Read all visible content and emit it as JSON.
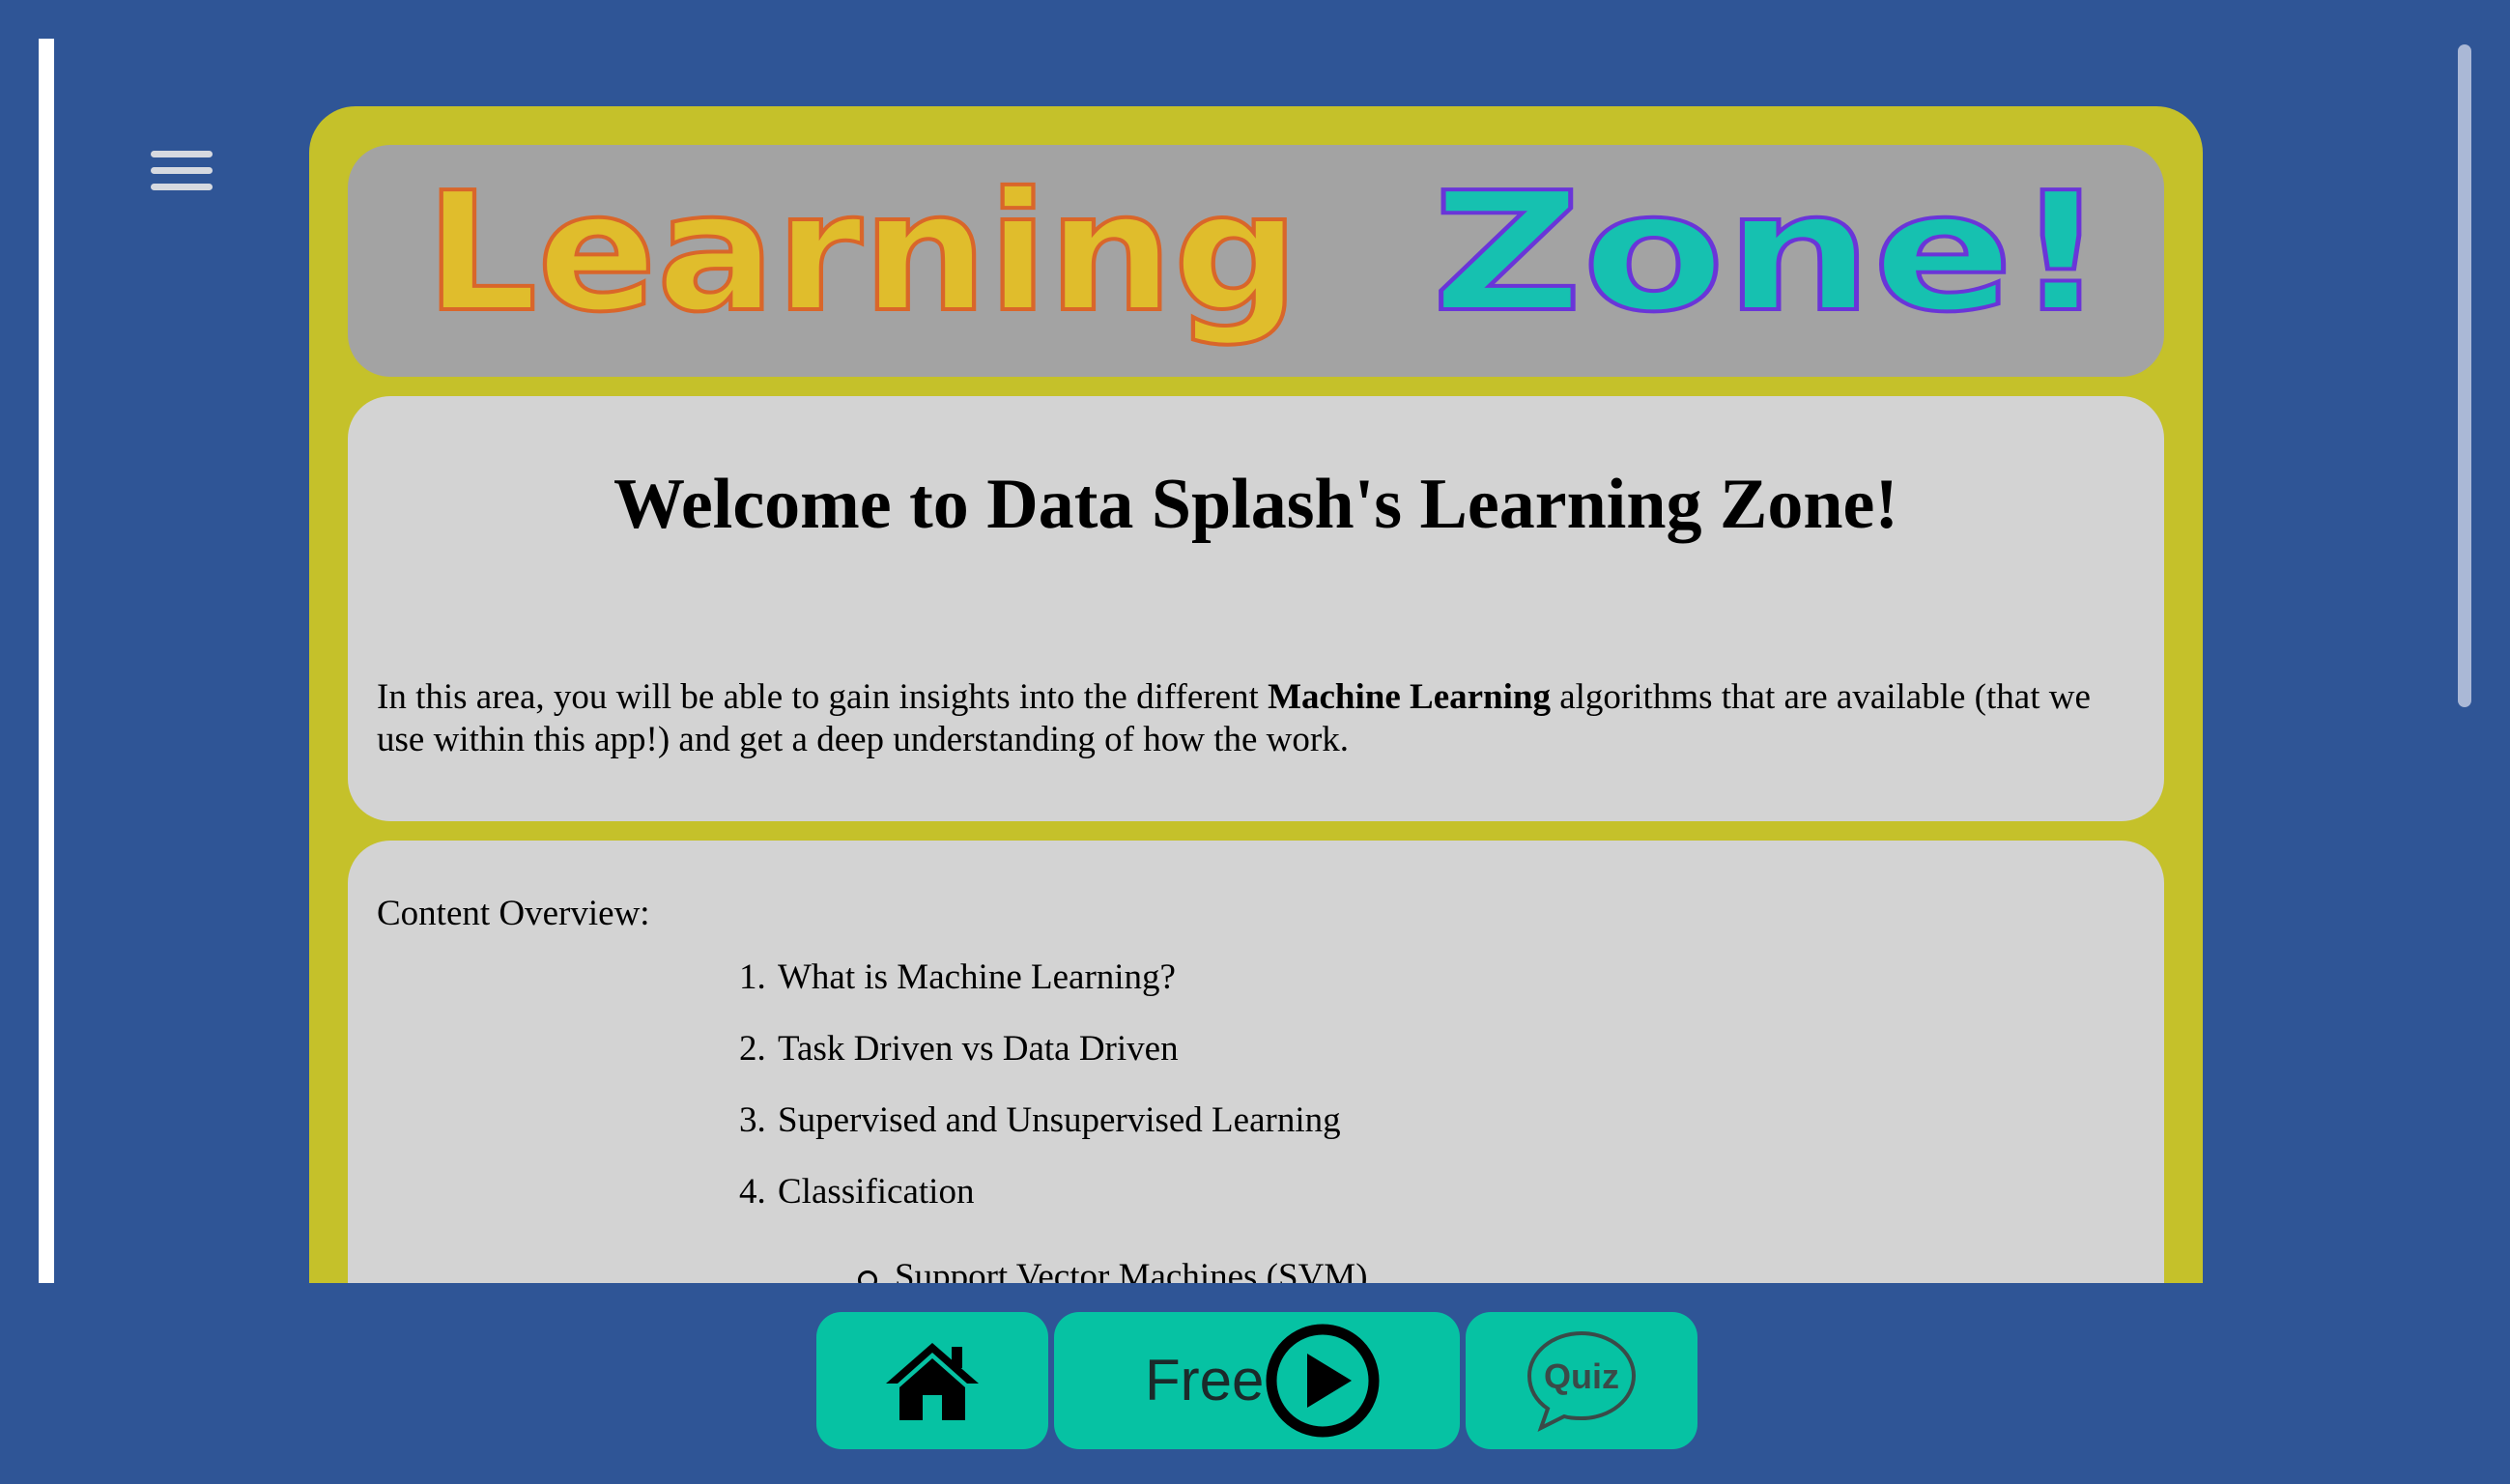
{
  "menu": {
    "icon": "hamburger-menu-icon"
  },
  "banner": {
    "word1": "Learning",
    "word2": "Zone!",
    "colors": {
      "word1_fill": "#e0bd2c",
      "word1_stroke": "#d9662a",
      "word2_fill": "#16c1b0",
      "word2_stroke": "#6a35d8"
    }
  },
  "welcome": {
    "heading": "Welcome to Data Splash's Learning Zone!",
    "intro_before": "In this area, you will be able to gain insights into the different ",
    "intro_bold": "Machine Learning",
    "intro_after": " algorithms that are available (that we use within this app!) and get a deep understanding of how the work."
  },
  "overview": {
    "title": "Content Overview:",
    "items": [
      {
        "num": "1.",
        "label": "What is Machine Learning?"
      },
      {
        "num": "2.",
        "label": "Task Driven vs Data Driven"
      },
      {
        "num": "3.",
        "label": "Supervised and Unsupervised Learning"
      },
      {
        "num": "4.",
        "label": "Classification"
      }
    ],
    "subitems": [
      {
        "label": "Support Vector Machines (SVM)"
      }
    ]
  },
  "bottom_nav": {
    "home": {
      "icon": "home-icon"
    },
    "free": {
      "label": "Free",
      "icon": "play-circle-icon"
    },
    "quiz": {
      "label": "Quiz",
      "icon": "quiz-bubble-icon"
    }
  },
  "colors": {
    "page_bg": "#2f5596",
    "card_bg": "#c5c12a",
    "banner_bg": "#a3a3a3",
    "panel_bg": "#d3d3d3",
    "nav_button_bg": "#06c2a3"
  }
}
